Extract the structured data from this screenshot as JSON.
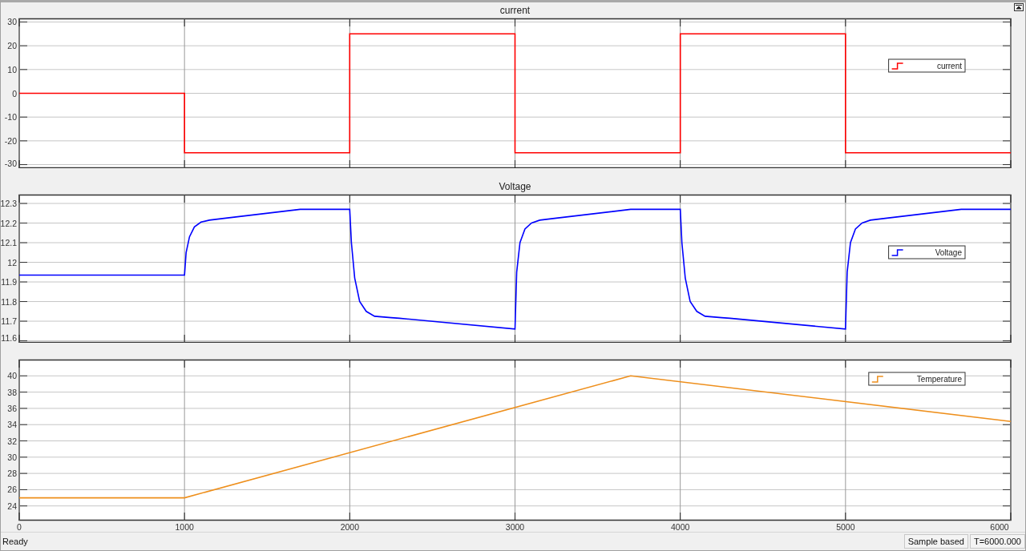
{
  "plots": [
    {
      "chart_data": {
        "type": "line",
        "title": "current",
        "grid": true,
        "x": [
          0,
          1000,
          1000,
          2000,
          2000,
          3000,
          3000,
          4000,
          4000,
          5000,
          5000,
          6000
        ],
        "xlim": [
          0,
          6000
        ],
        "ylim": [
          -31.5,
          31.5
        ],
        "yticks": [
          -30,
          -20,
          -10,
          0,
          10,
          20,
          30
        ],
        "series": [
          {
            "name": "current",
            "color": "#ff0000",
            "values": [
              0,
              0,
              -25,
              -25,
              25,
              25,
              -25,
              -25,
              25,
              25,
              -25,
              -25
            ]
          }
        ]
      }
    },
    {
      "chart_data": {
        "type": "line",
        "title": "Voltage",
        "grid": true,
        "x": [
          0,
          1000,
          1010,
          1030,
          1060,
          1100,
          1150,
          1250,
          1700,
          2000,
          2010,
          2030,
          2060,
          2100,
          2150,
          2250,
          2300,
          3000,
          3010,
          3030,
          3060,
          3100,
          3150,
          3250,
          3700,
          4000,
          4010,
          4030,
          4060,
          4100,
          4150,
          4250,
          4300,
          5000,
          5010,
          5030,
          5060,
          5100,
          5150,
          5250,
          5700,
          6000
        ],
        "xlim": [
          0,
          6000
        ],
        "ylim": [
          11.59,
          12.345
        ],
        "yticks": [
          11.6,
          11.7,
          11.8,
          11.9,
          12,
          12.1,
          12.2,
          12.3
        ],
        "series": [
          {
            "name": "Voltage",
            "color": "#0000ff",
            "values": [
              11.935,
              11.935,
              12.05,
              12.13,
              12.18,
              12.205,
              12.215,
              12.225,
              12.27,
              12.27,
              12.1,
              11.92,
              11.8,
              11.75,
              11.725,
              11.718,
              11.715,
              11.66,
              11.95,
              12.1,
              12.17,
              12.2,
              12.215,
              12.225,
              12.27,
              12.27,
              12.1,
              11.92,
              11.8,
              11.75,
              11.725,
              11.718,
              11.715,
              11.66,
              11.95,
              12.1,
              12.17,
              12.2,
              12.215,
              12.225,
              12.27,
              12.27
            ]
          }
        ]
      }
    },
    {
      "chart_data": {
        "type": "line",
        "grid": true,
        "x": [
          0,
          1000,
          3700,
          6000
        ],
        "xlim": [
          0,
          6000
        ],
        "ylim": [
          22.2,
          42
        ],
        "xticks": [
          0,
          1000,
          2000,
          3000,
          4000,
          5000,
          6000
        ],
        "yticks": [
          24,
          26,
          28,
          30,
          32,
          34,
          36,
          38,
          40
        ],
        "series": [
          {
            "name": "Temperature",
            "color": "#ee8f1c",
            "values": [
              25,
              25,
              40,
              34.4
            ]
          }
        ]
      }
    }
  ],
  "status_bar": {
    "message": "Ready",
    "mode": "Sample based",
    "time": "T=6000.000"
  }
}
